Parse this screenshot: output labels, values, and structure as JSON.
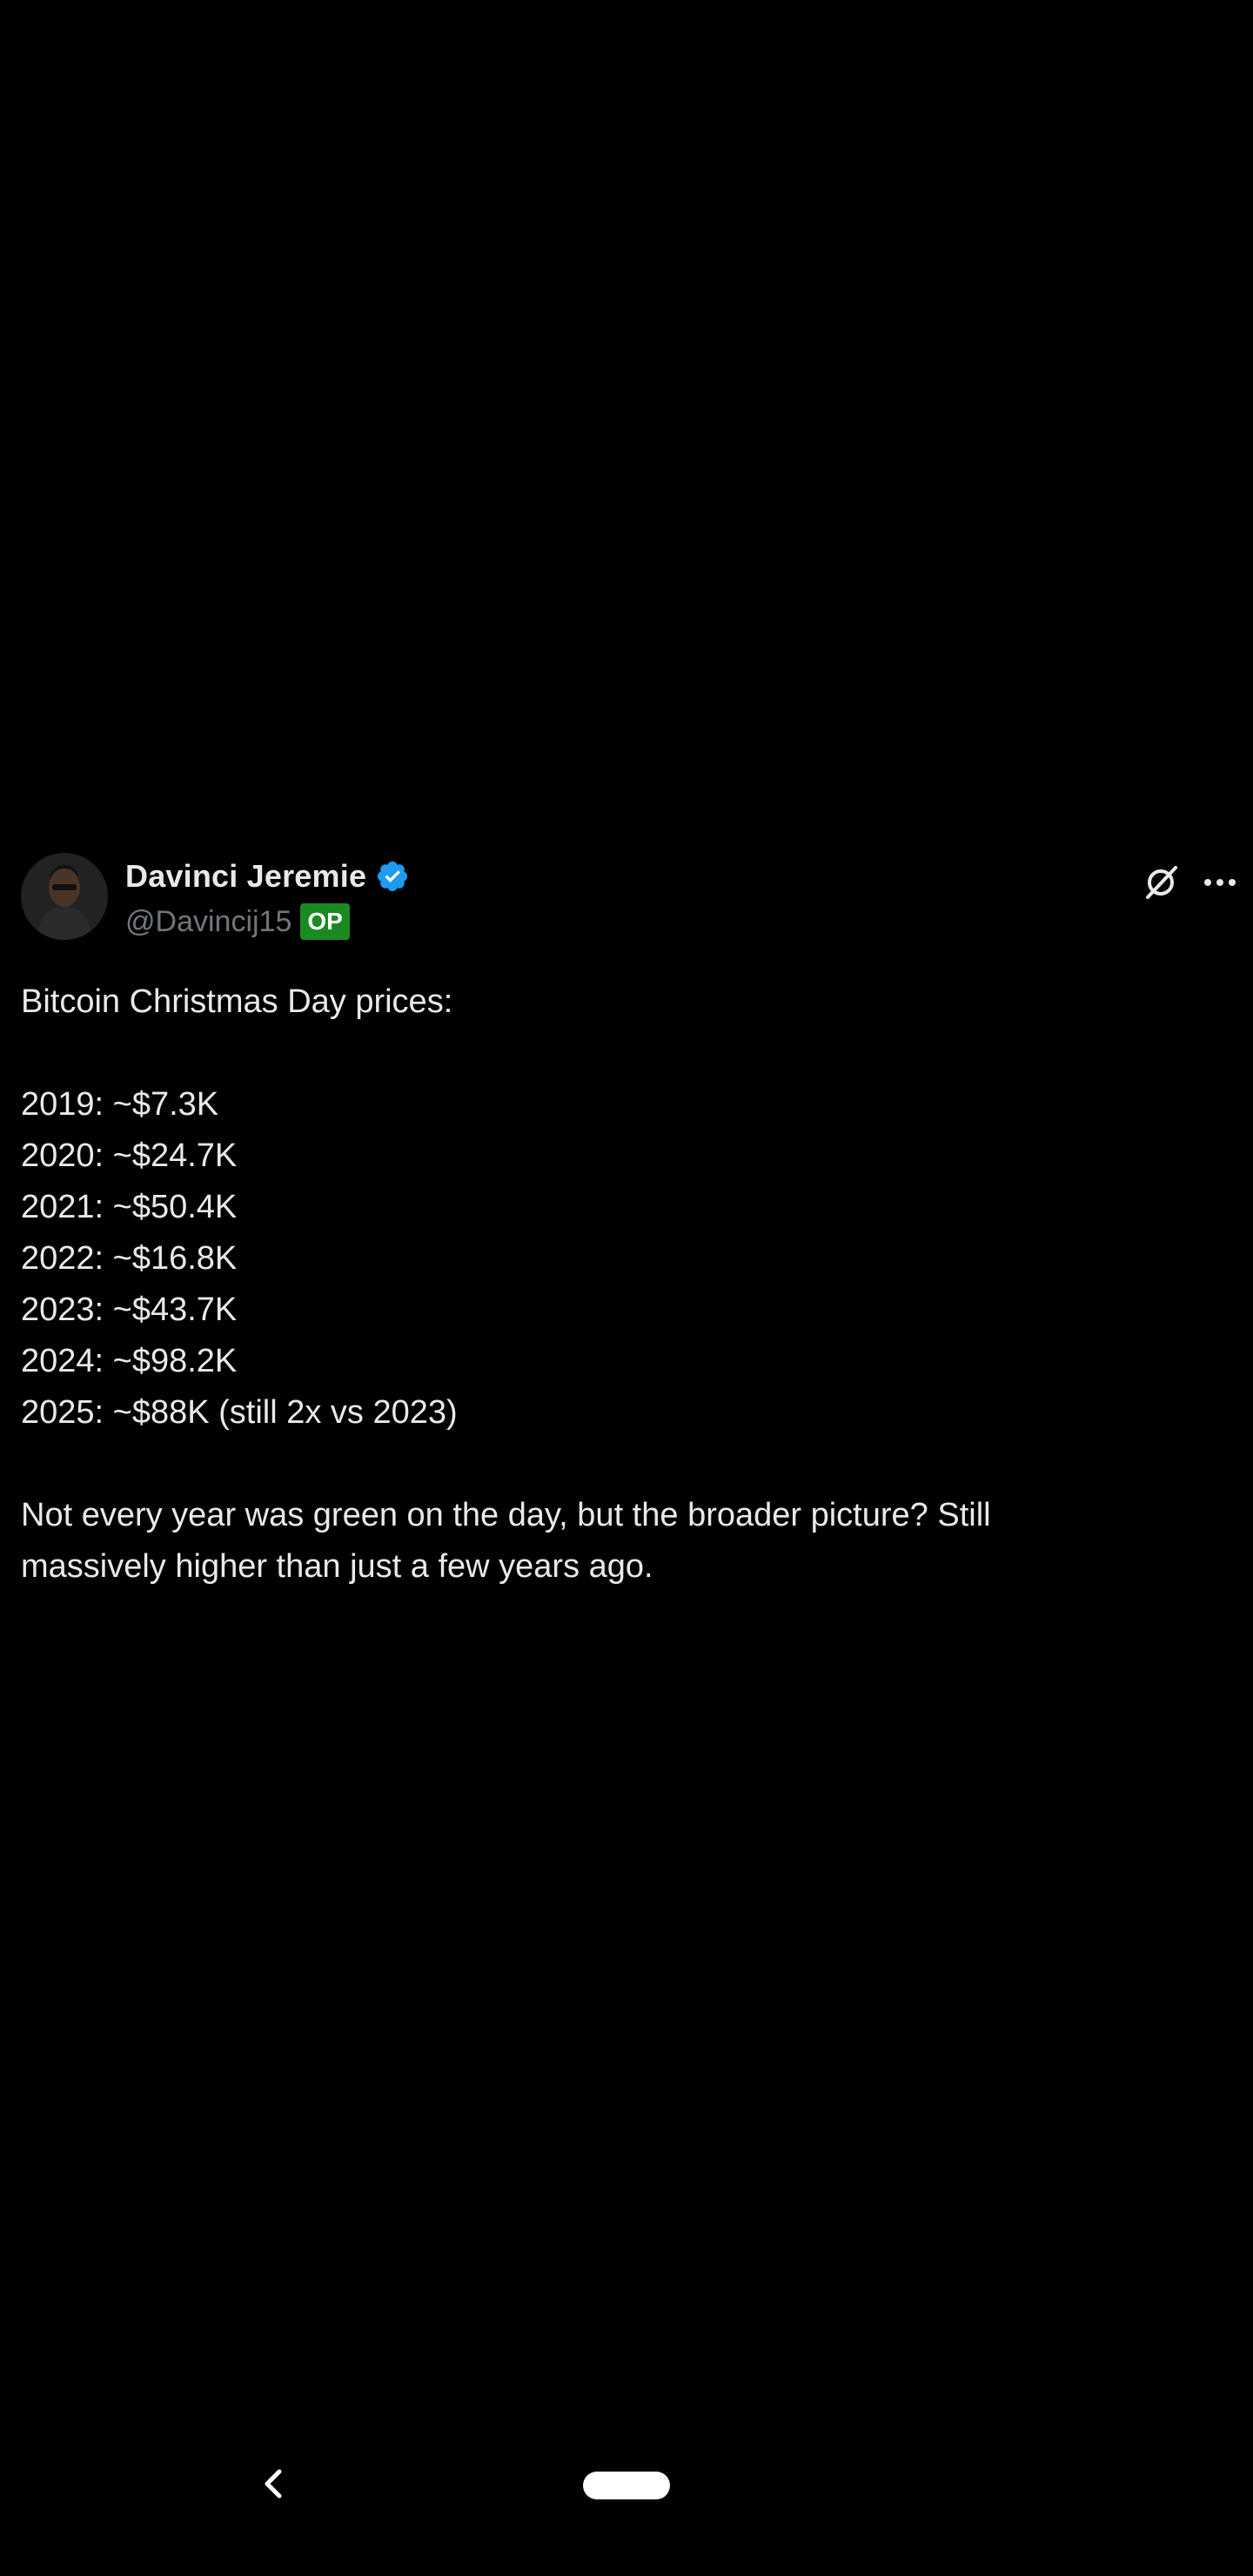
{
  "post": {
    "author": {
      "display_name": "Davinci Jeremie",
      "handle": "@Davincij15",
      "badge": "OP",
      "verified_color": "#1d9bf0",
      "badge_color": "#1a8a23"
    },
    "icons": {
      "grok": "grok-icon",
      "more": "more-icon",
      "verified": "verified-badge-icon"
    },
    "body": {
      "intro": "Bitcoin Christmas Day prices:",
      "prices": [
        "2019: ~$7.3K",
        "2020: ~$24.7K",
        "2021: ~$50.4K",
        "2022: ~$16.8K",
        "2023: ~$43.7K",
        "2024: ~$98.2K",
        "2025: ~$88K (still 2x vs 2023)"
      ],
      "closing_line1": "Not every year was green on the day, but the broader picture? Still",
      "closing_line2": "massively higher than just a few years ago."
    }
  },
  "system_nav": {
    "back_icon": "back-chevron-icon",
    "home": "home-pill"
  },
  "colors": {
    "background": "#000000",
    "text": "#e7e9ea",
    "secondary_text": "#71767b"
  }
}
